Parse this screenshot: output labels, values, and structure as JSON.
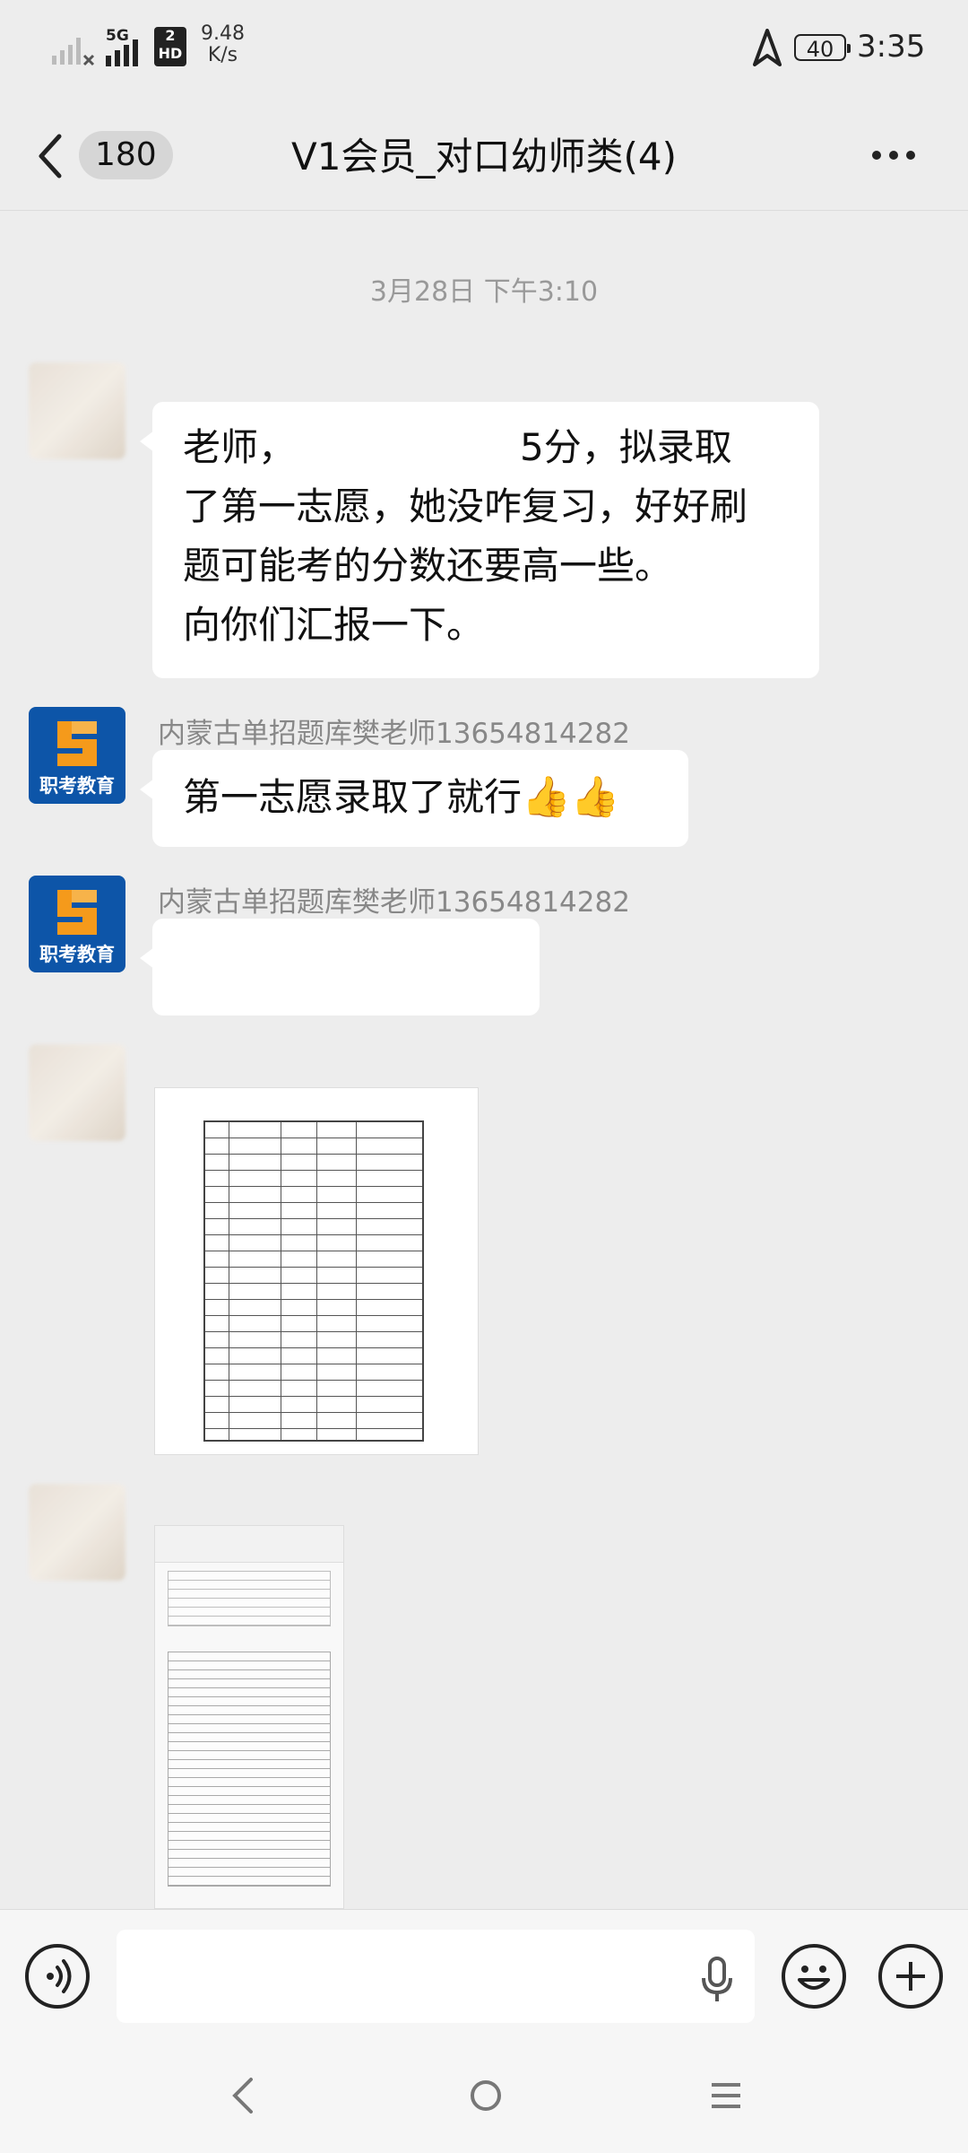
{
  "status_bar": {
    "network_5g": "5G",
    "hd_badge_top": "2",
    "hd_badge_bottom": "HD",
    "speed_value": "9.48",
    "speed_unit": "K/s",
    "battery": "40",
    "time": "3:35"
  },
  "header": {
    "unread_count": "180",
    "title": "V1会员_对口幼师类(4)"
  },
  "chat": {
    "timestamp": "3月28日 下午3:10",
    "messages": [
      {
        "line1": "老师，",
        "line1_tail": "5分，拟录取",
        "line2": "了第一志愿，她没咋复习，好好刷",
        "line3": "题可能考的分数还要高一些。",
        "line4": "向你们汇报一下。"
      },
      {
        "sender": "内蒙古单招题库樊老师13654814282",
        "text": "第一志愿录取了就行",
        "emoji": "👍👍"
      },
      {
        "sender": "内蒙古单招题库樊老师13654814282"
      }
    ],
    "brand_text": "职考教育"
  },
  "colors": {
    "background": "#ededed",
    "bubble": "#ffffff",
    "brand_blue": "#0d55a8",
    "brand_orange": "#f59a1b"
  }
}
